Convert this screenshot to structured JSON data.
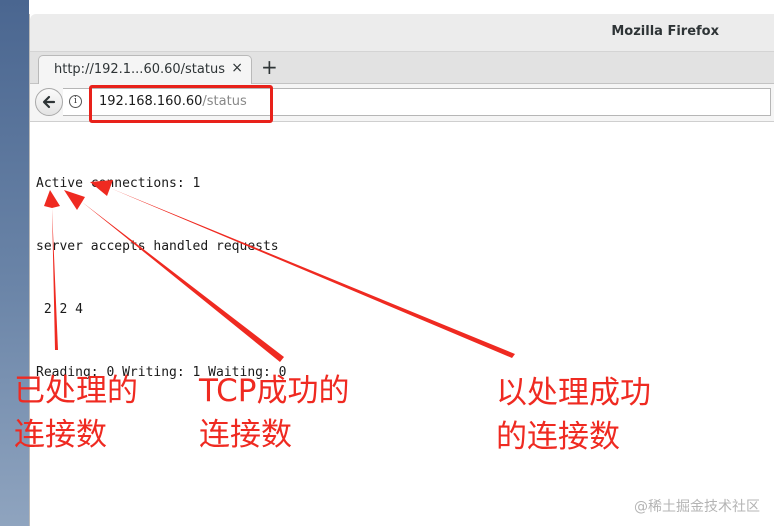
{
  "window": {
    "title": "Mozilla Firefox"
  },
  "tab": {
    "title": "http://192.1...60.60/status",
    "close_glyph": "×"
  },
  "tabstrip": {
    "new_tab_glyph": "+"
  },
  "urlbar": {
    "host": "192.168.160.60",
    "path": "/status",
    "info_glyph": "i"
  },
  "status_page": {
    "lines": [
      "Active connections: 1",
      "server accepts handled requests",
      " 2 2 4",
      "Reading: 0 Writing: 1 Waiting: 0"
    ]
  },
  "annotations": [
    {
      "line1": "已处理的",
      "line2": "连接数"
    },
    {
      "line1": "TCP成功的",
      "line2": "连接数"
    },
    {
      "line1": "以处理成功",
      "line2": "的连接数"
    }
  ],
  "watermark": "@稀土掘金技术社区",
  "colors": {
    "annotation_red": "#ef2a21",
    "highlight_red": "#e8211a"
  },
  "icons": {
    "back": "back-arrow-icon",
    "info": "info-icon"
  }
}
